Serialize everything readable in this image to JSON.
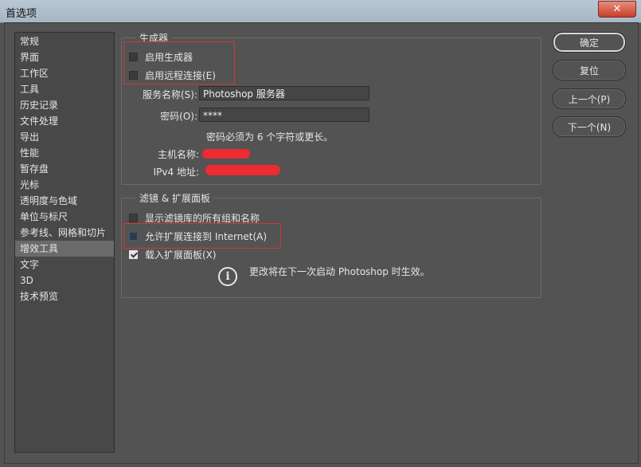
{
  "window": {
    "title": "首选项",
    "close_glyph": "✕"
  },
  "sidebar": {
    "items": [
      "常规",
      "界面",
      "工作区",
      "工具",
      "历史记录",
      "文件处理",
      "导出",
      "性能",
      "暂存盘",
      "光标",
      "透明度与色域",
      "单位与标尺",
      "参考线、网格和切片",
      "增效工具",
      "文字",
      "3D",
      "技术预览"
    ],
    "selected": "增效工具"
  },
  "generator": {
    "legend": "生成器",
    "enable_generator": "启用生成器",
    "enable_remote": "启用远程连接(E)",
    "service_name_label": "服务名称(S):",
    "service_name_value": "Photoshop 服务器",
    "password_label": "密码(O):",
    "password_value": "****",
    "password_hint": "密码必须为 6 个字符或更长。",
    "host_label": "主机名称:",
    "ipv4_label": "IPv4 地址:"
  },
  "filters": {
    "legend": "滤镜 & 扩展面板",
    "show_all_filters": "显示滤镜库的所有组和名称",
    "allow_internet": "允许扩展连接到 Internet(A)",
    "load_panels": "载入扩展面板(X)",
    "restart_note": "更改将在下一次启动 Photoshop 时生效。",
    "info_glyph": "i"
  },
  "buttons": {
    "ok": "确定",
    "reset": "复位",
    "prev": "上一个(P)",
    "next": "下一个(N)"
  },
  "colors": {
    "background": "#535353",
    "highlight_box": "#d33636",
    "redaction": "#ee2b30"
  }
}
